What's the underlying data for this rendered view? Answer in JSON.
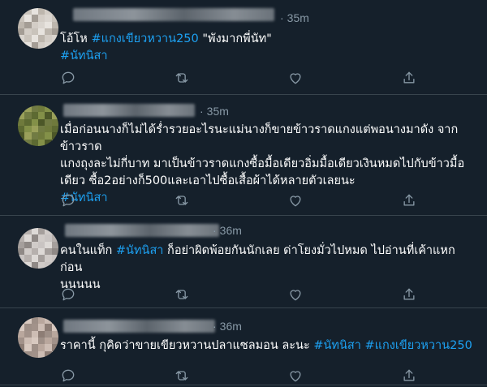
{
  "tweets": [
    {
      "time": "35m",
      "text_parts": [
        {
          "t": "โอ้โห ",
          "h": false
        },
        {
          "t": "#แกงเขียวหวาน250",
          "h": true
        },
        {
          "t": " \"พังมากพี่นัท\"",
          "h": false
        },
        {
          "t": "\n",
          "h": false
        },
        {
          "t": "#นัทนิสา",
          "h": true
        }
      ]
    },
    {
      "time": "35m",
      "text_parts": [
        {
          "t": "เมื่อก่อนนางก็ไม่ได้ร่ำรวยอะไรนะแม่นางก็ขายข้าวราดแกงแต่พอนางมาดัง จากข้าวราด\nแกงถุงละไม่กี่บาท มาเป็นข้าวราดแกงซื้อมื้อเดียวอิ่มมื้อเดียวเงินหมดไปกับข้าวมื้อ\nเดียว ซื้อ2อย่างก็500และเอาไปซื้อเสื้อผ้าได้หลายตัวเลยนะ\n",
          "h": false
        },
        {
          "t": "#นัทนิสา",
          "h": true
        }
      ]
    },
    {
      "time": "36m",
      "text_parts": [
        {
          "t": "คนในแท็ก ",
          "h": false
        },
        {
          "t": "#นัทนิสา",
          "h": true
        },
        {
          "t": " ก็อย่าผิดพ้อยกันนักเลย ด่าโยงมั่วไปหมด ไปอ่านที่เค้าแหกก่อน\nนนนนน",
          "h": false
        }
      ]
    },
    {
      "time": "36m",
      "text_parts": [
        {
          "t": "ราคานี้ กุคิดว่าขายเขียวหวานปลาแซลมอน ละนะ ",
          "h": false
        },
        {
          "t": "#นัทนิสา",
          "h": true
        },
        {
          "t": " ",
          "h": false
        },
        {
          "t": "#แกงเขียวหวาน250",
          "h": true
        }
      ]
    }
  ],
  "icons": [
    "reply-icon",
    "retweet-icon",
    "like-icon",
    "share-icon"
  ],
  "colors": {
    "background": "#15202b",
    "text": "#ffffff",
    "muted": "#8899a6",
    "hashtag": "#1da1f2",
    "divider": "#38444d"
  }
}
